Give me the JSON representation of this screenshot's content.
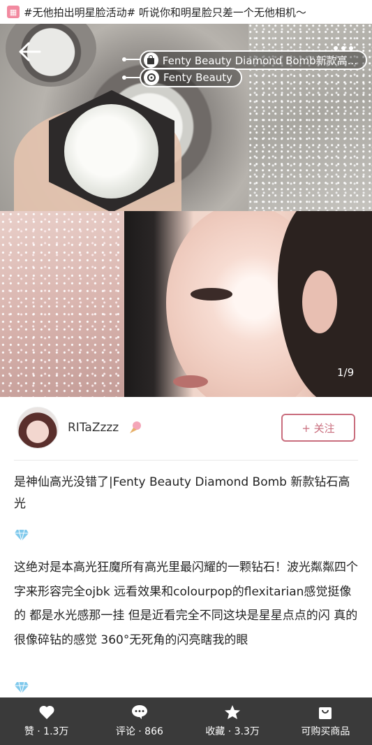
{
  "banner": {
    "text": "#无他拍出明星脸活动# 听说你和明星脸只差一个无他相机～"
  },
  "photo": {
    "tags": [
      {
        "label": "Fenty Beauty Diamond Bomb新款高..."
      },
      {
        "label": "Fenty Beauty"
      }
    ],
    "page_indicator": "1/9"
  },
  "author": {
    "name": "RITaZzzz",
    "follow_label": "+ 关注"
  },
  "post": {
    "title": "是神仙高光没错了|Fenty Beauty Diamond Bomb 新款钻石高光",
    "body": "这绝对是本高光狂魔所有高光里最闪耀的一颗钻石！波光粼粼四个字来形容完全ojbk 远看效果和colourpop的flexitarian感觉挺像的 都是水光感那一挂 但是近看完全不同这块是星星点点的闪 真的很像碎钻的感觉 360°无死角的闪亮瞎我的眼"
  },
  "bottom_bar": {
    "like": "赞 · 1.3万",
    "comment": "评论 · 866",
    "favorite": "收藏 · 3.3万",
    "buy": "可购买商品"
  },
  "colors": {
    "accent": "#c96d7d",
    "bar": "#3a3a3a"
  }
}
